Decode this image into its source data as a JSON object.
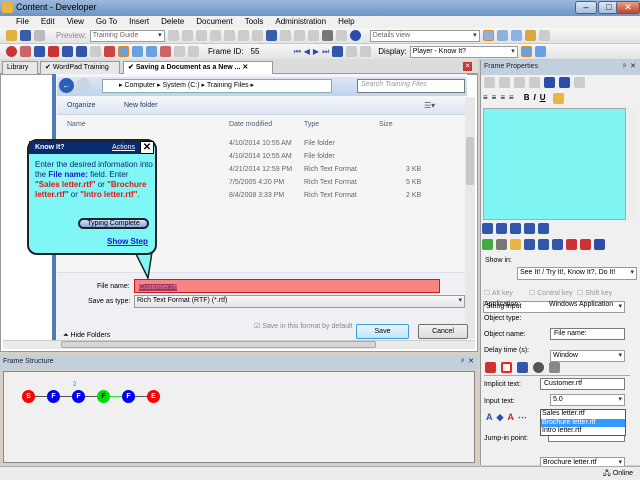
{
  "window": {
    "title": "Content - Developer"
  },
  "menu": [
    "File",
    "Edit",
    "View",
    "Go To",
    "Insert",
    "Delete",
    "Document",
    "Tools",
    "Administration",
    "Help"
  ],
  "toolbar": {
    "preview_label": "Preview:",
    "preview_value": "Training Guide",
    "view_value": "Details view",
    "frame_id_label": "Frame ID:",
    "frame_id": "55",
    "display_label": "Display:",
    "display_value": "Player - Know It?"
  },
  "tabs": [
    {
      "label": "Library"
    },
    {
      "label": "WordPad Training"
    },
    {
      "label": "Saving a Document as a New ..."
    }
  ],
  "dialog": {
    "breadcrumb": [
      "Computer",
      "System (C:)",
      "Training Files"
    ],
    "search_placeholder": "Search Training Files",
    "organize": "Organize",
    "new_folder": "New folder",
    "columns": [
      "Name",
      "Date modified",
      "Type",
      "Size"
    ],
    "rows": [
      {
        "date": "4/10/2014 10:55 AM",
        "type": "File folder",
        "size": ""
      },
      {
        "date": "4/10/2014 10:55 AM",
        "type": "File folder",
        "size": ""
      },
      {
        "date": "4/21/2014 12:59 PM",
        "type": "Rich Text Format",
        "size": "3 KB"
      },
      {
        "date": "7/5/2005 4:20 PM",
        "type": "Rich Text Format",
        "size": "5 KB"
      },
      {
        "date": "8/4/2008 3:33 PM",
        "type": "Rich Text Format",
        "size": "2 KB"
      }
    ],
    "file_name_label": "File name:",
    "file_name_value": "Customer.rtf",
    "save_type_label": "Save as type:",
    "save_type_value": "Rich Text Format (RTF) (*.rtf)",
    "save_default": "Save in this format by default",
    "save": "Save",
    "cancel": "Cancel",
    "hide_folders": "Hide Folders"
  },
  "bubble": {
    "title": "Know It?",
    "actions": "Actions",
    "text1": "Enter the desired information into the ",
    "field": "File name:",
    "text2": " field. Enter ",
    "opt1": "\"Sales letter.rtf\"",
    "or1": " or ",
    "opt2": "\"Brochure letter.rtf\"",
    "or2": " or ",
    "opt3": "\"Intro letter.rtf\"",
    "end": ".",
    "typing_complete": "Typing Complete",
    "show_step": "Show Step"
  },
  "frame_structure": {
    "title": "Frame Structure",
    "nodes": [
      {
        "label": "S",
        "color": "#ff0000"
      },
      {
        "label": "F",
        "color": "#0000ee"
      },
      {
        "label": "F",
        "color": "#0000ee",
        "badge": "2"
      },
      {
        "label": "F",
        "color": "#00dd00"
      },
      {
        "label": "F",
        "color": "#0000ee"
      },
      {
        "label": "E",
        "color": "#ff0000"
      }
    ]
  },
  "frame_properties": {
    "title": "Frame Properties",
    "show_in_label": "Show in:",
    "show_in_value": "See It! / Try It!, Know It?, Do It!",
    "action_type": "String input",
    "alt_key": "Alt key",
    "control_key": "Control key",
    "shift_key": "Shift key",
    "application_label": "Application:",
    "application_value": "Windows Application",
    "object_type_label": "Object type:",
    "object_type_value": "Window",
    "object_name_label": "Object name:",
    "object_name_value": "File name:",
    "delay_label": "Delay time (s):",
    "delay_value": "5.0",
    "implicit_label": "Implicit text:",
    "implicit_value": "Customer.rtf",
    "input_label": "Input text:",
    "input_value": "Brochure letter.rtf",
    "input_options": [
      "Sales letter.rtf",
      "Brochure letter.rtf",
      "Intro letter.rtf"
    ],
    "jump_label": "Jump-in point:"
  },
  "status": {
    "online": "Online"
  }
}
